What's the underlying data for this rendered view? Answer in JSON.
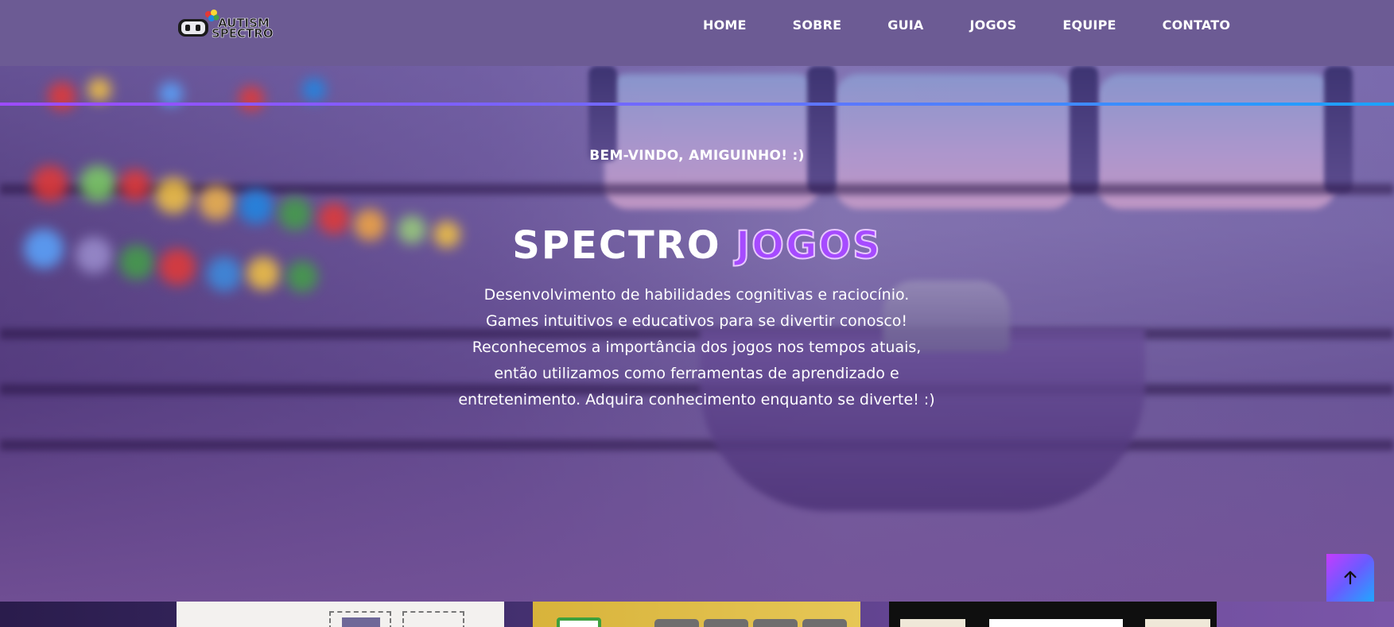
{
  "brand": {
    "logo_text_top": "AUTISM",
    "logo_text_bottom": "SPECTRO"
  },
  "nav": {
    "items": [
      {
        "label": "HOME"
      },
      {
        "label": "SOBRE"
      },
      {
        "label": "GUIA"
      },
      {
        "label": "JOGOS"
      },
      {
        "label": "EQUIPE"
      },
      {
        "label": "CONTATO"
      }
    ]
  },
  "hero": {
    "welcome": "BEM-VINDO, AMIGUINHO! :)",
    "title_main": "SPECTRO",
    "title_accent": "JOGOS",
    "description": "Desenvolvimento de habilidades cognitivas e raciocínio. Games intuitivos e educativos para se divertir conosco! Reconhecemos a importância dos jogos nos tempos atuais, então utilizamos como ferramentas de aprendizado e entretenimento. Adquira conhecimento enquanto se diverte! :)"
  },
  "back_to_top": {
    "icon": "arrow-up-icon"
  },
  "colors": {
    "header_bg": "#6c5b94",
    "accent_purple": "#a64bff",
    "accent_blue": "#1aa3ff"
  }
}
